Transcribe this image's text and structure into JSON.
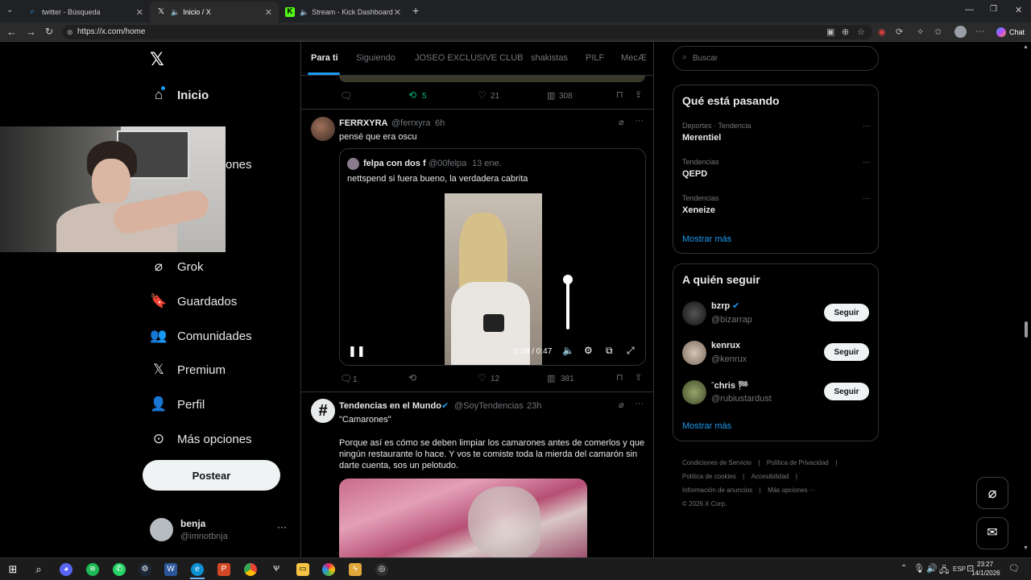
{
  "browser": {
    "tabs": [
      {
        "title": "twitter - Búsqueda",
        "icon": "search-icon"
      },
      {
        "title": "Inicio / X",
        "icon": "x-logo-icon"
      },
      {
        "title": "Stream - Kick Dashboard",
        "icon": "kick-icon"
      }
    ],
    "url": "https://x.com/home",
    "chat_label": "Chat"
  },
  "sidebar": {
    "items": [
      {
        "label": "Inicio",
        "icon": "home-icon"
      },
      {
        "label": "Grok",
        "icon": "grok-icon"
      },
      {
        "label": "Guardados",
        "icon": "bookmark-icon"
      },
      {
        "label": "Comunidades",
        "icon": "communities-icon"
      },
      {
        "label": "Premium",
        "icon": "x-premium-icon"
      },
      {
        "label": "Perfil",
        "icon": "profile-icon"
      },
      {
        "label": "Más opciones",
        "icon": "more-options-icon"
      }
    ],
    "partial_label": "ones",
    "post_label": "Postear",
    "account": {
      "name": "benja",
      "handle": "@imnotbnja"
    }
  },
  "feed": {
    "tabs": [
      "Para ti",
      "Siguiendo",
      "JOSEO EXCLUSIVE CLUB",
      "shakistas",
      "PILF",
      "MecÆ"
    ],
    "top_actions": {
      "retweets": "5",
      "likes": "21",
      "views": "308"
    },
    "post1": {
      "name": "FERRXYRA",
      "handle": "@ferrxyra",
      "time": "6h",
      "text": "pensé que era oscu",
      "quote": {
        "name": "felpa con dos f",
        "handle": "@00felpa",
        "time": "13 ene.",
        "text": "nettspend si fuera bueno, la verdadera cabrita"
      },
      "video_time": "0:08 / 0:47",
      "volume_level": 0.85,
      "replies": "1",
      "likes": "12",
      "views": "381"
    },
    "post2": {
      "name": "Tendencias en el Mundo",
      "handle": "@SoyTendencias",
      "time": "23h",
      "title": "\"Camarones\"",
      "text": "Porque así es cómo se deben limpiar los camarones antes de comerlos y que ningún restaurante lo hace. Y vos te comiste toda la mierda del camarón sin darte cuenta, sos un pelotudo."
    }
  },
  "right": {
    "search_placeholder": "Buscar",
    "trending_title": "Qué está pasando",
    "trends": [
      {
        "meta": "Deportes · Tendencia",
        "name": "Merentiel"
      },
      {
        "meta": "Tendencias",
        "name": "QEPD"
      },
      {
        "meta": "Tendencias",
        "name": "Xeneize"
      }
    ],
    "show_more": "Mostrar más",
    "follow_title": "A quién seguir",
    "follow": [
      {
        "name": "bzrp",
        "handle": "@bizarrap",
        "verified": true
      },
      {
        "name": "kenrux",
        "handle": "@kenrux",
        "verified": false
      },
      {
        "name": "ˉchris 🏁",
        "handle": "@rubiustardust",
        "verified": false
      }
    ],
    "follow_btn": "Seguir",
    "footer": [
      "Condiciones de Servicio",
      "Política de Privacidad",
      "Política de cookies",
      "Accesibilidad",
      "Información de anuncios",
      "Más opciones ···"
    ],
    "copyright": "© 2026 X Corp."
  },
  "taskbar": {
    "lang": "ESP",
    "time": "23:27",
    "date": "14/1/2026"
  }
}
